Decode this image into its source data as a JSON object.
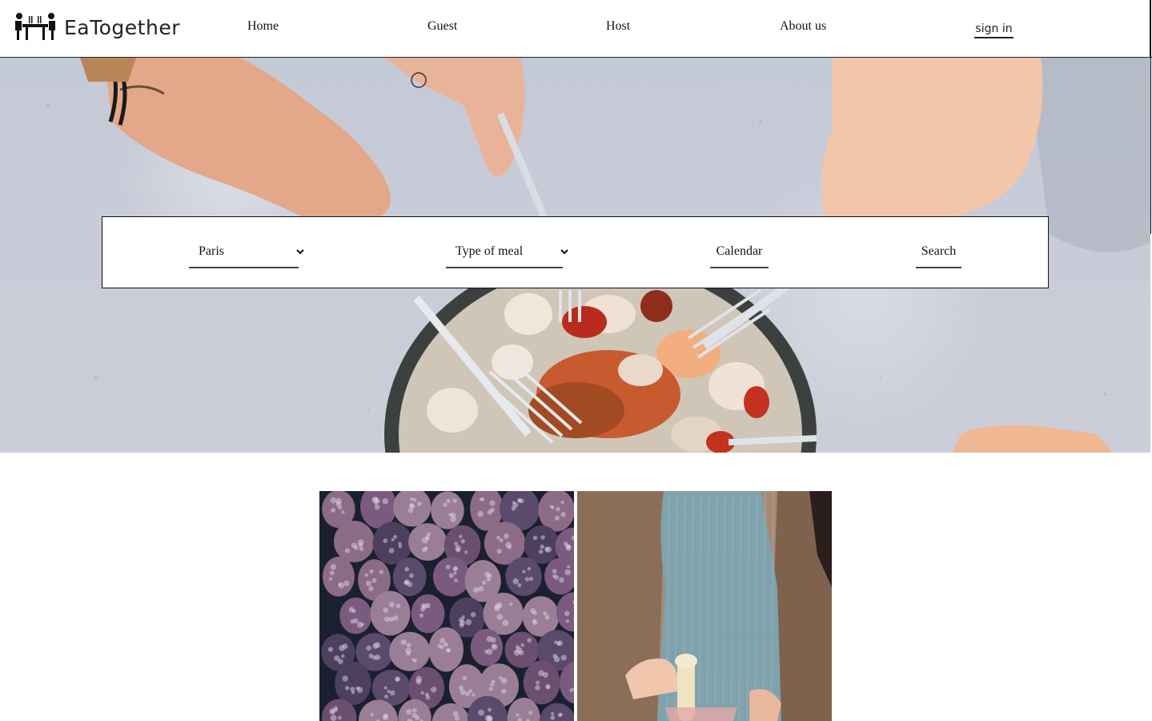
{
  "brand": {
    "name": "EaTogether",
    "logo_icon": "dining-table-people-icon"
  },
  "nav": {
    "items": [
      {
        "label": "Home"
      },
      {
        "label": "Guest"
      },
      {
        "label": "Host"
      },
      {
        "label": "About us"
      }
    ],
    "sign_in": "sign in"
  },
  "hero": {
    "image": "hands-sharing-seafood-plate-photo"
  },
  "search": {
    "city": {
      "value": "Paris",
      "icon": "chevron-down-icon"
    },
    "meal_type": {
      "value": "Type of meal",
      "icon": "chevron-down-icon"
    },
    "calendar_label": "Calendar",
    "search_label": "Search"
  },
  "gallery": {
    "tiles": [
      {
        "image": "frozen-blackberries-photo"
      },
      {
        "image": "person-in-apron-with-pestle-photo"
      }
    ]
  },
  "colors": {
    "text": "#111111",
    "background": "#ffffff",
    "hero_bg": "#c8ccd7"
  }
}
